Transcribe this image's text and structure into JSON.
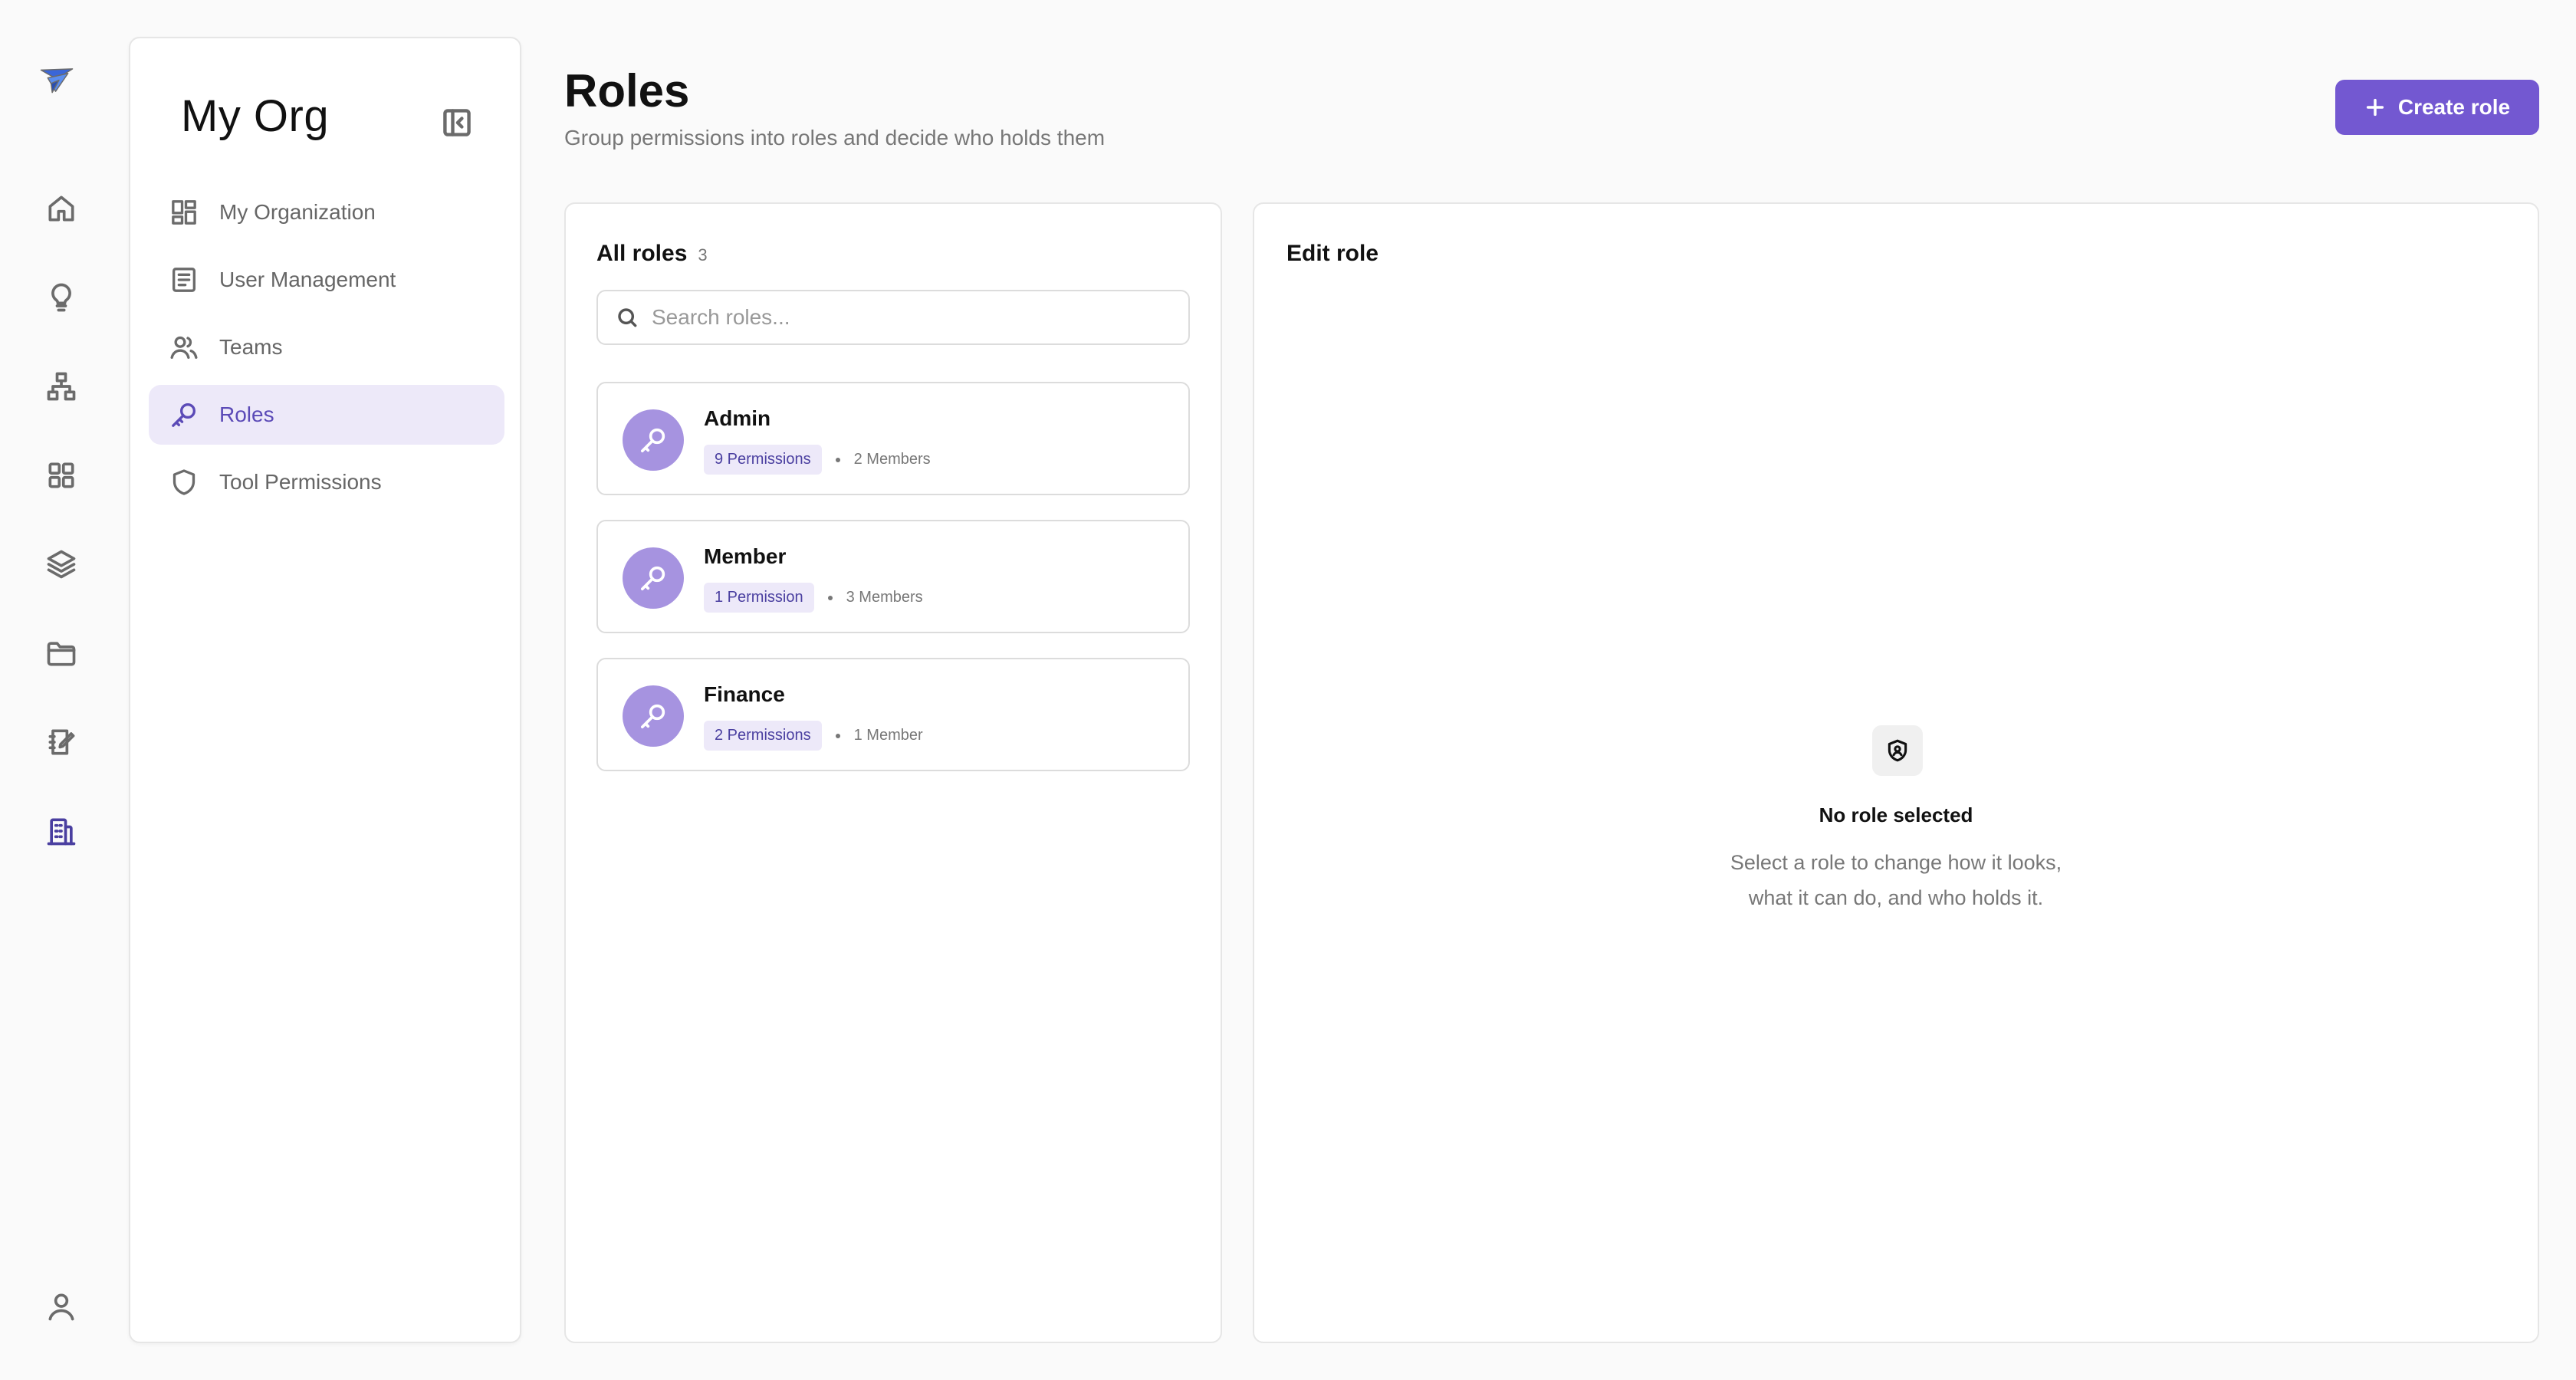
{
  "rail": {
    "items": [
      "home-icon",
      "lightbulb-icon",
      "hierarchy-icon",
      "grid-icon",
      "layers-icon",
      "folder-icon",
      "notebook-icon",
      "building-icon",
      "user-icon"
    ],
    "active": "building-icon"
  },
  "sidebar": {
    "title": "My Org",
    "items": [
      {
        "label": "My Organization",
        "icon": "dashboard-icon"
      },
      {
        "label": "User Management",
        "icon": "list-icon"
      },
      {
        "label": "Teams",
        "icon": "users-icon"
      },
      {
        "label": "Roles",
        "icon": "key-icon",
        "active": true
      },
      {
        "label": "Tool Permissions",
        "icon": "shield-icon"
      }
    ]
  },
  "header": {
    "title": "Roles",
    "subtitle": "Group permissions into roles and decide who holds them",
    "create_label": "Create role"
  },
  "roles_panel": {
    "title": "All roles",
    "count": "3",
    "search_placeholder": "Search roles...",
    "roles": [
      {
        "name": "Admin",
        "permissions": "9 Permissions",
        "members": "2 Members"
      },
      {
        "name": "Member",
        "permissions": "1 Permission",
        "members": "3 Members"
      },
      {
        "name": "Finance",
        "permissions": "2 Permissions",
        "members": "1 Member"
      }
    ]
  },
  "edit_panel": {
    "title": "Edit role",
    "empty_title": "No role selected",
    "empty_line1": "Select a role to change how it looks,",
    "empty_line2": "what it can do, and who holds it."
  },
  "colors": {
    "accent": "#7358d1",
    "accent_soft": "#ede9f9",
    "avatar": "#a693e0"
  }
}
